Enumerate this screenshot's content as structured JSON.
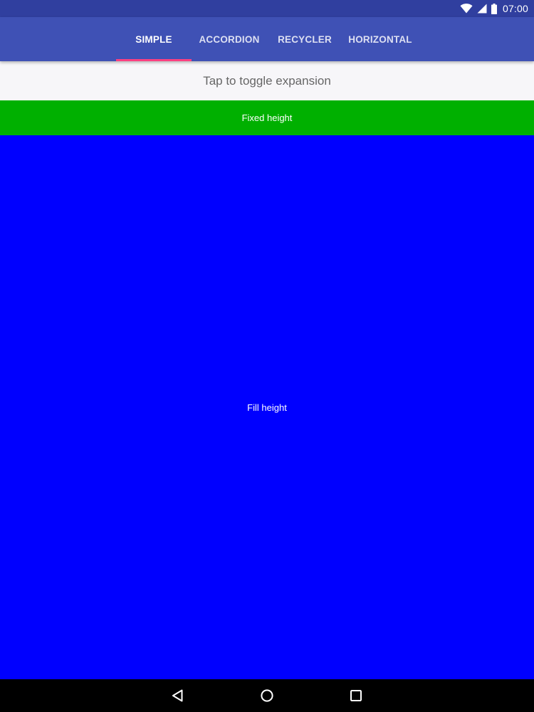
{
  "status_bar": {
    "time": "07:00",
    "icons": [
      "wifi-icon",
      "cellular-signal-icon",
      "battery-icon"
    ]
  },
  "tabs": [
    {
      "label": "SIMPLE",
      "active": true
    },
    {
      "label": "ACCORDION",
      "active": false
    },
    {
      "label": "RECYCLER",
      "active": false
    },
    {
      "label": "HORIZONTAL",
      "active": false
    }
  ],
  "content": {
    "toggle_label": "Tap to toggle expansion",
    "fixed_label": "Fixed height",
    "fill_label": "Fill height"
  },
  "navigation": {
    "icons": [
      "back-icon",
      "home-icon",
      "recents-icon"
    ]
  },
  "colors": {
    "status_bar": "#303f9f",
    "app_bar": "#3f51b5",
    "tab_indicator": "#ff4081",
    "toggle_background": "#f7f6f9",
    "fixed_section": "#00b000",
    "fill_section": "#0000ff",
    "nav_bar": "#000000"
  }
}
